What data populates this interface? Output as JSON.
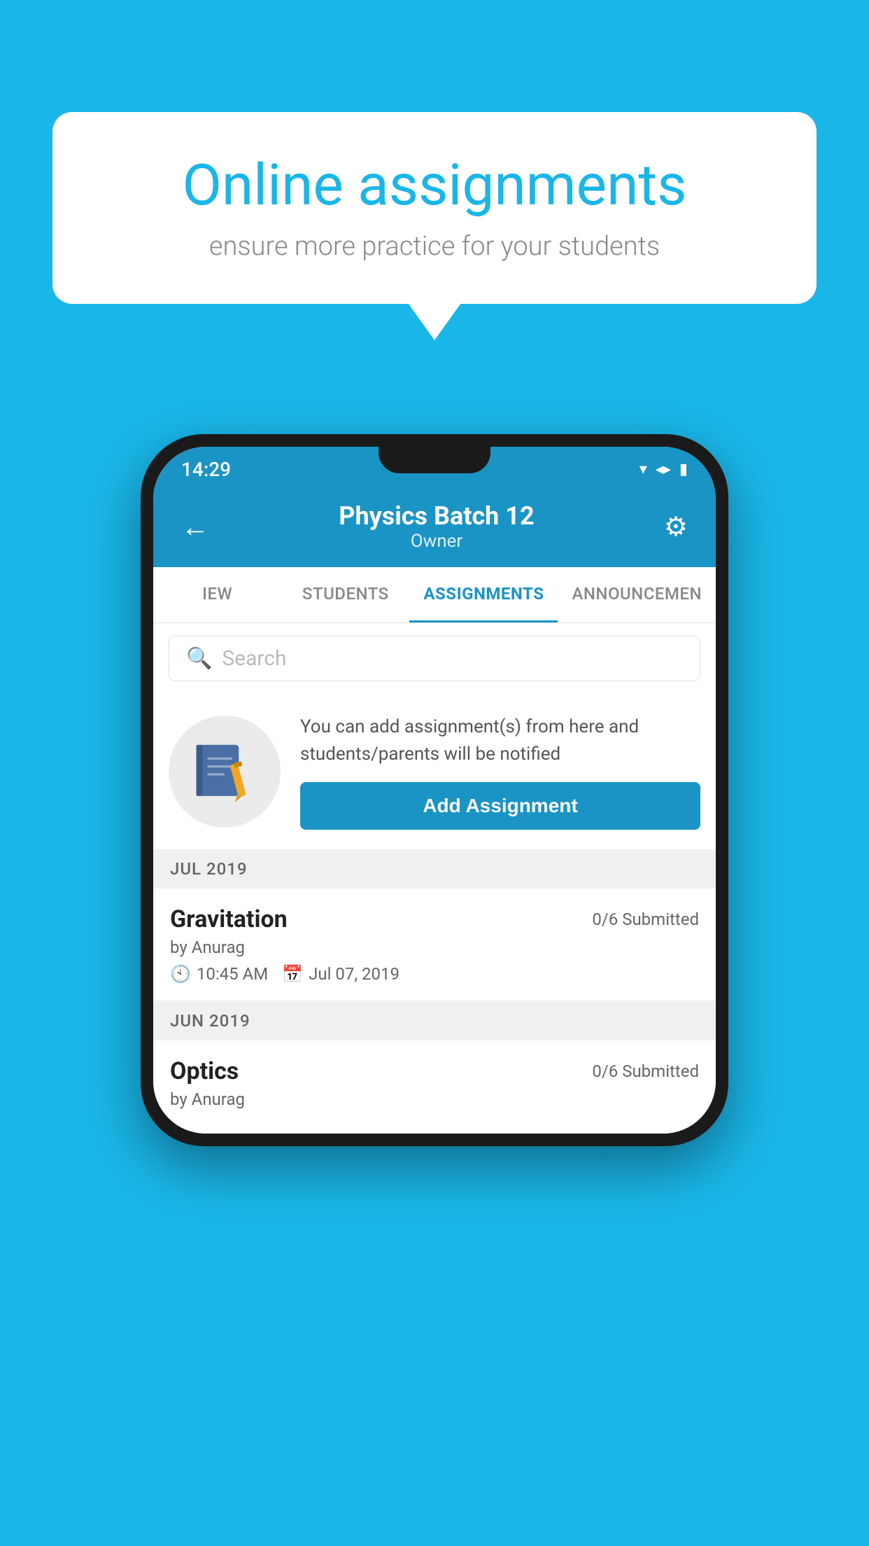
{
  "background_color": "#1ab6e8",
  "speech_bubble": {
    "title": "Online assignments",
    "subtitle": "ensure more practice for your students"
  },
  "phone": {
    "status_bar": {
      "time": "14:29"
    },
    "header": {
      "title": "Physics Batch 12",
      "subtitle": "Owner",
      "back_label": "←",
      "settings_label": "⚙"
    },
    "tabs": [
      {
        "label": "IEW",
        "active": false
      },
      {
        "label": "STUDENTS",
        "active": false
      },
      {
        "label": "ASSIGNMENTS",
        "active": true
      },
      {
        "label": "ANNOUNCEMENTS",
        "active": false
      }
    ],
    "search": {
      "placeholder": "Search"
    },
    "info_section": {
      "text": "You can add assignment(s) from here and students/parents will be notified",
      "button_label": "Add Assignment"
    },
    "sections": [
      {
        "label": "JUL 2019",
        "assignments": [
          {
            "name": "Gravitation",
            "submitted": "0/6 Submitted",
            "author": "by Anurag",
            "time": "10:45 AM",
            "date": "Jul 07, 2019"
          }
        ]
      },
      {
        "label": "JUN 2019",
        "assignments": [
          {
            "name": "Optics",
            "submitted": "0/6 Submitted",
            "author": "by Anurag",
            "time": "",
            "date": ""
          }
        ]
      }
    ]
  }
}
